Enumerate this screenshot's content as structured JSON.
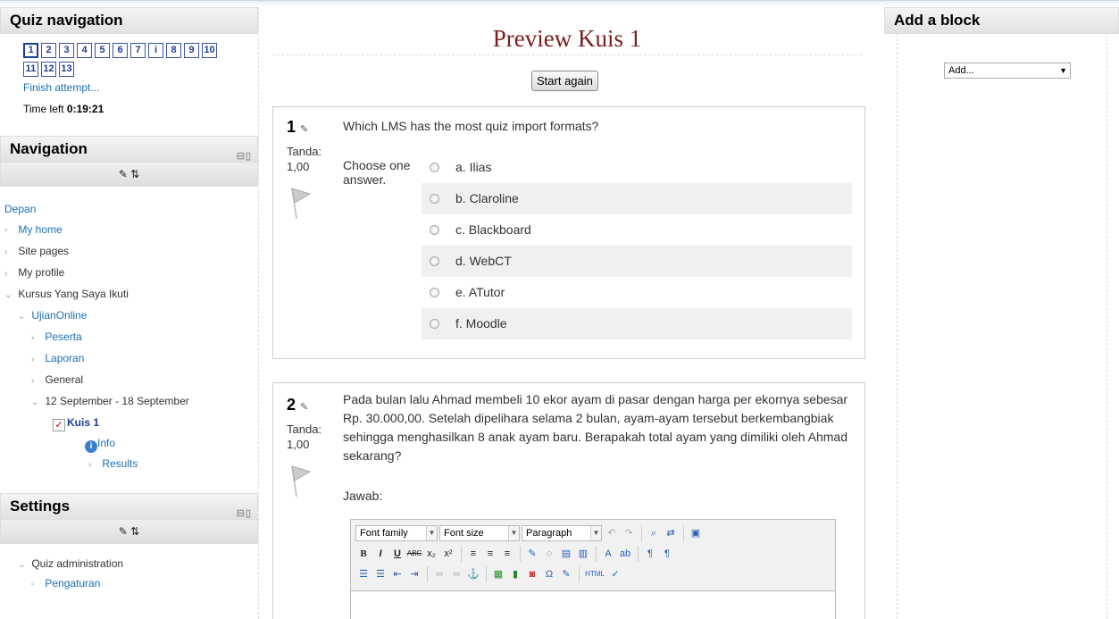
{
  "quiz_nav": {
    "title": "Quiz navigation",
    "buttons": [
      "1",
      "2",
      "3",
      "4",
      "5",
      "6",
      "7",
      "i",
      "8",
      "9",
      "10",
      "11",
      "12",
      "13"
    ],
    "finish": "Finish attempt...",
    "time_label": "Time left ",
    "time_value": "0:19:21"
  },
  "navigation": {
    "title": "Navigation",
    "items": [
      {
        "label": "Depan"
      },
      {
        "label": "My home"
      },
      {
        "label": "Site pages"
      },
      {
        "label": "My profile"
      },
      {
        "label": "Kursus Yang Saya Ikuti"
      },
      {
        "label": "UjianOnline"
      },
      {
        "label": "Peserta"
      },
      {
        "label": "Laporan"
      },
      {
        "label": "General"
      },
      {
        "label": "12 September - 18 September"
      },
      {
        "label": "Kuis 1"
      },
      {
        "label": "Info"
      },
      {
        "label": "Results"
      }
    ]
  },
  "settings": {
    "title": "Settings",
    "items": [
      {
        "label": "Quiz administration"
      },
      {
        "label": "Pengaturan"
      }
    ]
  },
  "main": {
    "title": "Preview Kuis 1",
    "start_again": "Start again",
    "q1": {
      "no": "1",
      "mark_label": "Tanda:",
      "mark_value": "1,00",
      "text": "Which LMS has the most quiz import formats?",
      "prompt": "Choose one answer.",
      "answers": [
        "a. Ilias",
        "b. Claroline",
        "c. Blackboard",
        "d. WebCT",
        "e. ATutor",
        "f. Moodle"
      ]
    },
    "q2": {
      "no": "2",
      "mark_label": "Tanda:",
      "mark_value": "1,00",
      "text": "Pada bulan lalu Ahmad membeli 10 ekor ayam di pasar dengan harga per ekornya sebesar Rp. 30.000,00. Setelah dipelihara selama 2 bulan, ayam-ayam tersebut berkembangbiak sehingga menghasilkan 8 anak ayam baru. Berapakah total ayam yang dimiliki oleh Ahmad sekarang?",
      "answer_label": "Jawab:"
    },
    "editor": {
      "font_family": "Font family",
      "font_size": "Font size",
      "format": "Paragraph"
    }
  },
  "add_block": {
    "title": "Add a block",
    "select_value": "Add..."
  }
}
